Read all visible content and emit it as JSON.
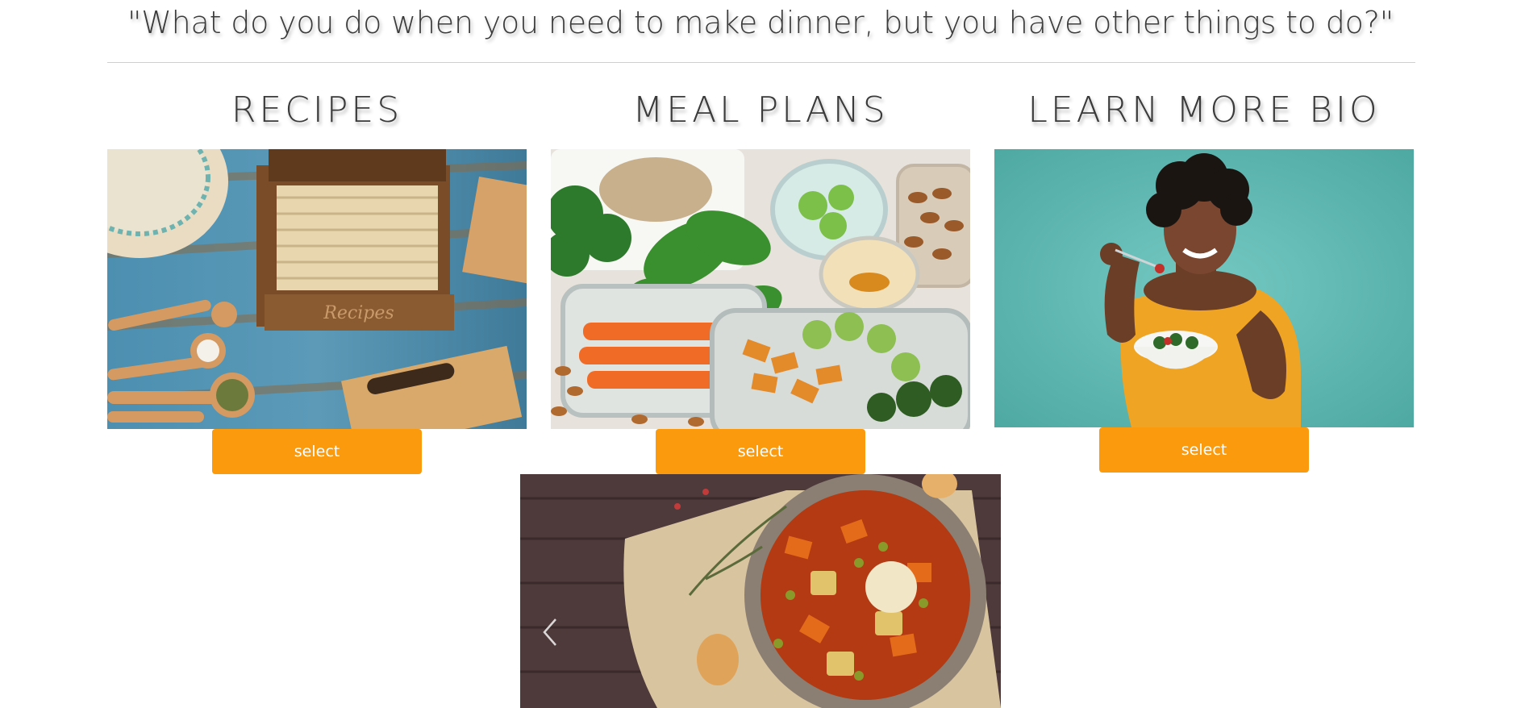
{
  "header": {
    "quote": "\"What do you do when you need to make dinner, but you have other things to do?\""
  },
  "cards": [
    {
      "title": "RECIPES",
      "button_label": "select",
      "image_alt": "recipe box with recipe cards and measuring spoons"
    },
    {
      "title": "MEAL PLANS",
      "button_label": "select",
      "image_alt": "meal prep containers with vegetables and almonds"
    },
    {
      "title": "LEARN MORE BIO",
      "button_label": "select",
      "image_alt": "smiling woman eating a salad"
    }
  ],
  "carousel": {
    "image_alt": "bowl of vegetable stew on wooden table",
    "prev_icon": "chevron-left-icon"
  },
  "colors": {
    "accent": "#fb9a0c",
    "text": "#3a3a3a",
    "teal": "#62bcb6"
  }
}
